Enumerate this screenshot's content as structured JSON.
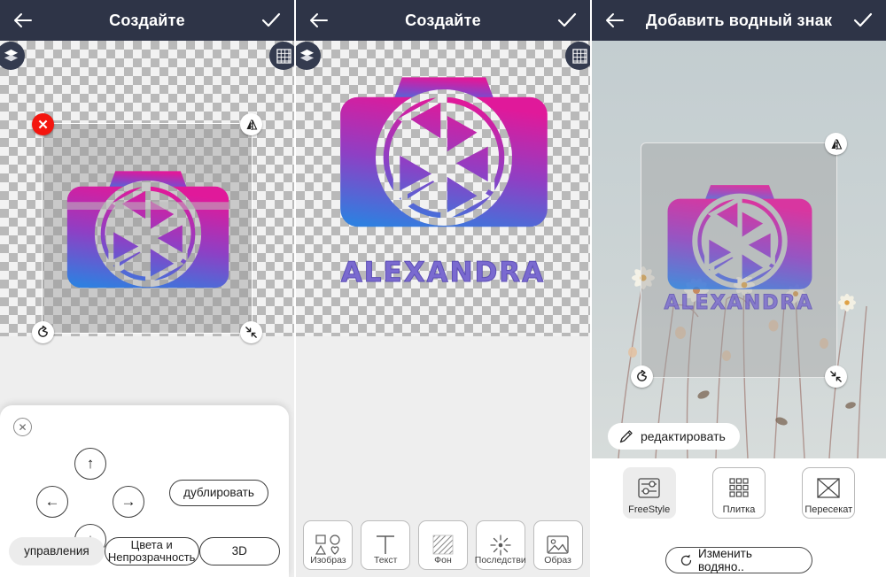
{
  "panels": [
    {
      "id": "create-transform",
      "header": {
        "title": "Создайте",
        "back_icon": "arrow-left-icon",
        "confirm_icon": "check-icon"
      },
      "canvas": {
        "layers_icon": "layers-stack-icon",
        "grid_icon": "grid-icon",
        "selection": {
          "delete_icon": "close-circle-icon",
          "flip_icon": "flip-horizontal-icon",
          "rotate_icon": "rotate-icon",
          "resize_icon": "resize-diagonal-icon"
        }
      },
      "sheet": {
        "close_icon": "close-circle-icon",
        "dpad": {
          "up_icon": "arrow-up-icon",
          "left_icon": "arrow-left-icon",
          "right_icon": "arrow-right-icon",
          "down_icon": "arrow-down-icon"
        },
        "duplicate_label": "дублировать",
        "tabs": [
          {
            "label": "управления",
            "active": true
          },
          {
            "label": "Цвета и Непрозрачность",
            "active": false
          },
          {
            "label": "3D",
            "active": false
          }
        ]
      }
    },
    {
      "id": "create-tools",
      "header": {
        "title": "Создайте",
        "back_icon": "arrow-left-icon",
        "confirm_icon": "check-icon"
      },
      "canvas": {
        "layers_icon": "layers-stack-icon",
        "grid_icon": "grid-icon"
      },
      "tools": [
        {
          "label": "Изобраз",
          "icon": "shapes-icon"
        },
        {
          "label": "Текст",
          "icon": "text-t-icon"
        },
        {
          "label": "Фон",
          "icon": "hatch-pattern-icon"
        },
        {
          "label": "Последстви",
          "icon": "sparkle-icon"
        },
        {
          "label": "Образ",
          "icon": "picture-icon"
        }
      ]
    },
    {
      "id": "add-watermark",
      "header": {
        "title": "Добавить водный знак",
        "back_icon": "arrow-left-icon",
        "confirm_icon": "check-icon"
      },
      "watermark": {
        "flip_icon": "flip-horizontal-icon",
        "rotate_icon": "rotate-icon",
        "resize_icon": "resize-diagonal-icon"
      },
      "edit_button": {
        "label": "редактировать",
        "icon": "pencil-icon"
      },
      "modes": [
        {
          "label": "FreeStyle",
          "icon": "sliders-icon",
          "active": true
        },
        {
          "label": "Плитка",
          "icon": "tile-grid-icon",
          "active": false
        },
        {
          "label": "Пересекат",
          "icon": "cross-square-icon",
          "active": false
        }
      ],
      "change_watermark": {
        "label": "Изменить водяно..",
        "icon": "refresh-icon"
      }
    }
  ],
  "logo": {
    "word": "ALEXANDRA",
    "gradient_from": "#e0199a",
    "gradient_to": "#2f7fe0",
    "word_color": "#7a6ad0"
  },
  "colors": {
    "appbar_bg": "#2e3447",
    "appbar_text": "#ffffff",
    "delete_red": "#f4160f",
    "canvas_grey": "#eeeeee",
    "active_chip": "#ececec",
    "photo_sky": "#c6d0d2"
  }
}
